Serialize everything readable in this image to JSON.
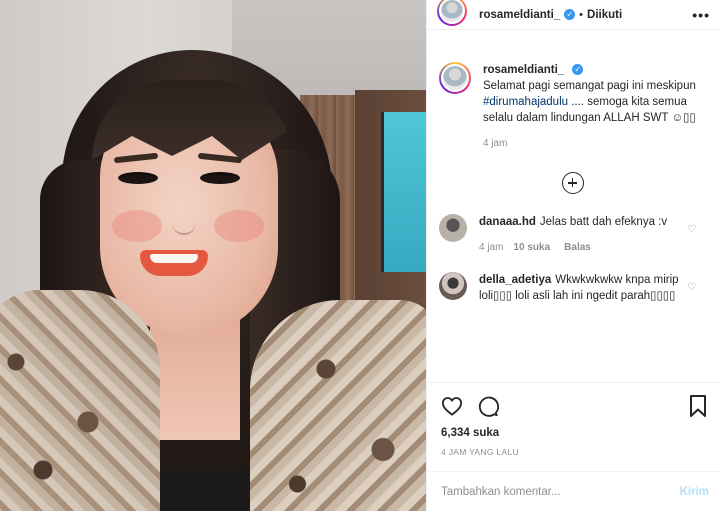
{
  "post": {
    "username": "rosameldianti_",
    "separator": "•",
    "follow_label": "Diikuti",
    "more_label": "•••",
    "caption_parts": {
      "before": "Selamat pagi semangat pagi ini meskipun ",
      "hashtag": "#dirumahajadulu",
      "after": " .... semoga kita semua selalu dalam lindungan ALLAH SWT ☺︎▯▯"
    },
    "caption_time": "4 jam",
    "likes": "6,334 suka",
    "timestamp": "4 JAM YANG LALU"
  },
  "comments": [
    {
      "username": "danaaa.hd",
      "text": "Jelas batt dah efeknya :v",
      "time": "4 jam",
      "likes": "10 suka",
      "reply_label": "Balas"
    },
    {
      "username": "della_adetiya",
      "text": "Wkwkwkwkw knpa mirip loli▯▯▯ loli asli lah ini ngedit parah▯▯▯▯"
    }
  ],
  "add_comment": {
    "placeholder": "Tambahkan komentar...",
    "send_label": "Kirim"
  },
  "icons": {
    "verified": "verified-badge-icon",
    "heart": "heart-icon",
    "comment": "comment-bubble-icon",
    "bookmark": "bookmark-icon",
    "load_more": "plus-circle-icon"
  },
  "colors": {
    "verified": "#3897f0",
    "send_disabled": "#b2dffc",
    "hashtag": "#003569"
  }
}
